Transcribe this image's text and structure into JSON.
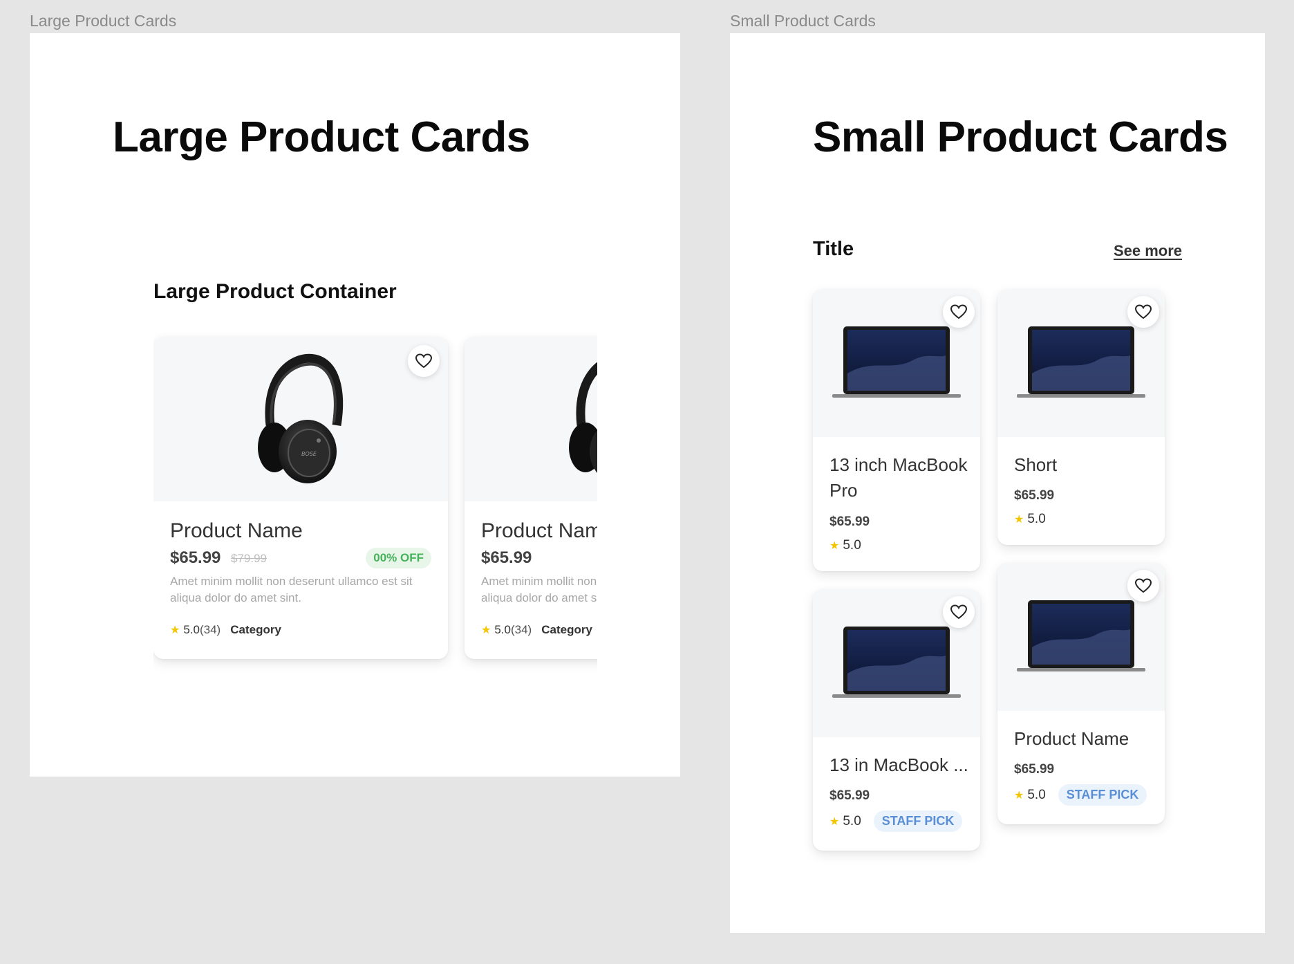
{
  "frames": {
    "large_label": "Large Product Cards",
    "small_label": "Small Product Cards"
  },
  "large": {
    "title": "Large Product Cards",
    "container_title": "Large Product Container",
    "cards": [
      {
        "name": "Product Name",
        "price": "$65.99",
        "old_price": "$79.99",
        "badge": "00% OFF",
        "description": "Amet minim mollit non deserunt ullamco est sit aliqua dolor do amet sint.",
        "rating": "5.0",
        "count": "(34)",
        "category": "Category",
        "icon": "headphones"
      },
      {
        "name": "Product Name",
        "price": "$65.99",
        "description": "Amet minim mollit non deserunt ullamco est sit aliqua dolor do amet sint.",
        "rating": "5.0",
        "count": "(34)",
        "category": "Category",
        "icon": "headphones"
      }
    ]
  },
  "small": {
    "title": "Small Product Cards",
    "section_title": "Title",
    "see_more": "See more",
    "cards": [
      {
        "name": "13 inch MacBook Pro",
        "price": "$65.99",
        "rating": "5.0",
        "badge": "",
        "icon": "laptop"
      },
      {
        "name": "Short",
        "price": "$65.99",
        "rating": "5.0",
        "badge": "",
        "icon": "laptop"
      },
      {
        "name": "13 in MacBook ...",
        "price": "$65.99",
        "rating": "5.0",
        "badge": "STAFF PICK",
        "icon": "laptop"
      },
      {
        "name": "Product Name",
        "price": "$65.99",
        "rating": "5.0",
        "badge": "STAFF PICK",
        "icon": "laptop"
      }
    ]
  },
  "colors": {
    "badge_off_text": "#46b35a",
    "badge_pick_text": "#5a8fd6",
    "star": "#f2c500"
  }
}
